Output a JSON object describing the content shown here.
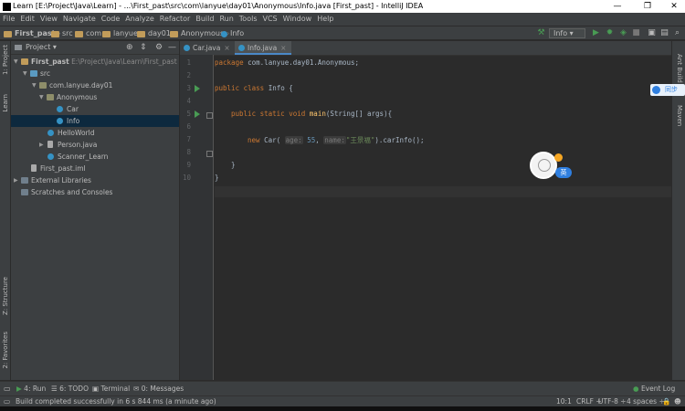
{
  "window": {
    "title": "Learn [E:\\Project\\Java\\Learn] - ...\\First_past\\src\\com\\lanyue\\day01\\Anonymous\\Info.java [First_past] - IntelliJ IDEA",
    "min_glyph": "—",
    "max_glyph": "❐",
    "close_glyph": "✕"
  },
  "menu": [
    "File",
    "Edit",
    "View",
    "Navigate",
    "Code",
    "Analyze",
    "Refactor",
    "Build",
    "Run",
    "Tools",
    "VCS",
    "Window",
    "Help"
  ],
  "breadcrumb": [
    "First_past",
    "src",
    "com",
    "lanyue",
    "day01",
    "Anonymous",
    "Info"
  ],
  "toolbar": {
    "run_config": "Info"
  },
  "left_strip": {
    "project": "1: Project",
    "learn": "Learn",
    "structure": "Z: Structure",
    "favorites": "2: Favorites"
  },
  "right_strip": {
    "ant": "Ant Build",
    "maven": "Maven"
  },
  "project_panel": {
    "title": "Project",
    "tree": [
      {
        "label": "First_past",
        "extra": "E:\\Project\\Java\\Learn\\First_past"
      },
      {
        "label": "src"
      },
      {
        "label": "com.lanyue.day01"
      },
      {
        "label": "Anonymous"
      },
      {
        "label": "Car"
      },
      {
        "label": "Info"
      },
      {
        "label": "HelloWorld"
      },
      {
        "label": "Person.java"
      },
      {
        "label": "Scanner_Learn"
      },
      {
        "label": "First_past.iml"
      },
      {
        "label": "External Libraries"
      },
      {
        "label": "Scratches and Consoles"
      }
    ]
  },
  "tabs": [
    {
      "label": "Car.java",
      "close": "×"
    },
    {
      "label": "Info.java",
      "close": "×"
    }
  ],
  "editor": {
    "line_numbers": [
      "1",
      "2",
      "3",
      "4",
      "5",
      "6",
      "7",
      "8",
      "9",
      "10"
    ],
    "code": {
      "l1_kw": "package ",
      "l1_rest": "com.lanyue.day01.Anonymous;",
      "l3_kw": "public class ",
      "l3_rest": "Info {",
      "l5_kw": "public static void ",
      "l5_fn": "main",
      "l5_rest": "(String[] args){",
      "l7_kw": "new ",
      "l7_cls": "Car(",
      "l7_hint1": "age:",
      "l7_num": "55",
      "l7_comma": ", ",
      "l7_hint2": "name:",
      "l7_str": "\"王景福\"",
      "l7_rest": ").carInfo();",
      "l8": "}",
      "l9": "}"
    }
  },
  "overlay": {
    "badge_text": "同步",
    "avatar_badge": "英"
  },
  "bottom_tools": {
    "run": "4: Run",
    "todo": "6: TODO",
    "terminal": "Terminal",
    "messages": "0: Messages",
    "event_log": "Event Log"
  },
  "status": {
    "message": "Build completed successfully in 6 s 844 ms (a minute ago)",
    "position": "10:1",
    "line_sep": "CRLF",
    "encoding": "UTF-8",
    "indent": "4 spaces"
  }
}
